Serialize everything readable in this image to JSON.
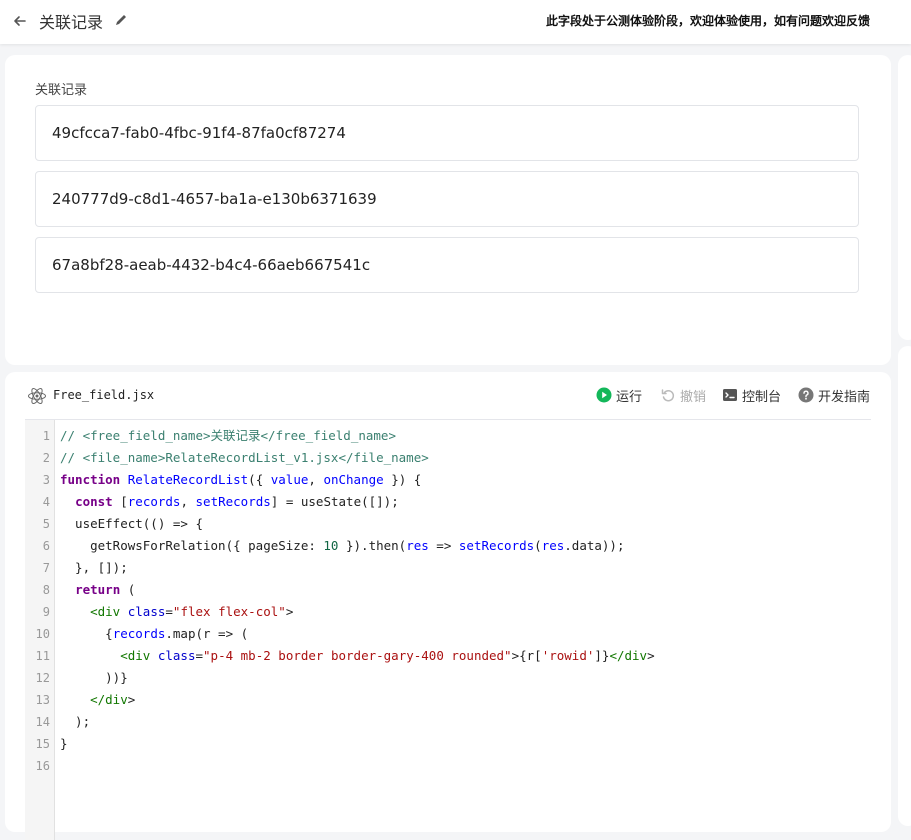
{
  "header": {
    "title": "关联记录",
    "notice": "此字段处于公测体验阶段，欢迎体验使用，如有问题欢迎反馈"
  },
  "preview": {
    "field_label": "关联记录",
    "records": [
      "49cfcca7-fab0-4fbc-91f4-87fa0cf87274",
      "240777d9-c8d1-4657-ba1a-e130b6371639",
      "67a8bf28-aeab-4432-b4c4-66aeb667541c"
    ]
  },
  "editor": {
    "filename": "Free_field.jsx",
    "run_label": "运行",
    "undo_label": "撤销",
    "console_label": "控制台",
    "guide_label": "开发指南",
    "line_numbers": [
      "1",
      "2",
      "3",
      "4",
      "5",
      "6",
      "7",
      "8",
      "9",
      "10",
      "11",
      "12",
      "13",
      "14",
      "15",
      "16"
    ],
    "code": [
      "// <free_field_name>关联记录</free_field_name>",
      "// <file_name>RelateRecordList_v1.jsx</file_name>",
      "function RelateRecordList({ value, onChange }) {",
      "  const [records, setRecords] = useState([]);",
      "  useEffect(() => {",
      "    getRowsForRelation({ pageSize: 10 }).then(res => setRecords(res.data));",
      "  }, []);",
      "  return (",
      "    <div class=\"flex flex-col\">",
      "      {records.map(r => (",
      "        <div class=\"p-4 mb-2 border border-gary-400 rounded\">{r['rowid']}</div>",
      "      ))}",
      "    </div>",
      "  );",
      "}",
      ""
    ]
  },
  "colors": {
    "accent_green": "#13b75a",
    "comment": "#3b8070",
    "keyword": "#770088"
  }
}
